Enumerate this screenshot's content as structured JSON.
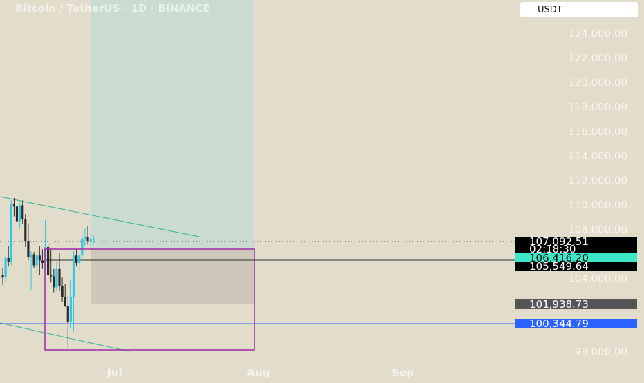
{
  "header": {
    "title": "Bitcoin / TetherUS · 1D · BINANCE",
    "currency_button": "USDT"
  },
  "colors": {
    "background": "#e2dccb",
    "up": "#2ec8e8",
    "down": "#2b2b2b",
    "profit_zone": "#c9dccf",
    "loss_zone": "#cdc8ba",
    "box_outline": "#a02aa8",
    "trendline": "#2db39a",
    "horizontal_line_blue": "#2962ff",
    "tag_current": "#000000",
    "tag_entry": "#3de8c8",
    "tag_gray": "#555555",
    "tag_blue": "#2962ff"
  },
  "chart_data": {
    "type": "candlestick",
    "title": "Bitcoin / TetherUS · 1D · BINANCE",
    "ylim": [
      97000,
      127000
    ],
    "y_ticks": [
      "124,000.00",
      "122,000.00",
      "120,000.00",
      "118,000.00",
      "116,000.00",
      "114,000.00",
      "112,000.00",
      "110,000.00",
      "108,000.00",
      "104,000.00",
      "98,000.00"
    ],
    "x_labels": [
      "Jul",
      "Aug",
      "Sep"
    ],
    "candles": [
      {
        "o": 104200,
        "h": 104800,
        "l": 103400,
        "c": 104000
      },
      {
        "o": 104000,
        "h": 105800,
        "l": 103600,
        "c": 105600
      },
      {
        "o": 105600,
        "h": 106600,
        "l": 104900,
        "c": 105300
      },
      {
        "o": 105300,
        "h": 110300,
        "l": 105000,
        "c": 110000
      },
      {
        "o": 110000,
        "h": 110500,
        "l": 109000,
        "c": 109800
      },
      {
        "o": 109800,
        "h": 110200,
        "l": 108300,
        "c": 108600
      },
      {
        "o": 108600,
        "h": 110100,
        "l": 108000,
        "c": 109900
      },
      {
        "o": 109900,
        "h": 110300,
        "l": 108400,
        "c": 108800
      },
      {
        "o": 108800,
        "h": 109200,
        "l": 106500,
        "c": 107000
      },
      {
        "o": 107000,
        "h": 108400,
        "l": 105400,
        "c": 105700
      },
      {
        "o": 105700,
        "h": 106200,
        "l": 103000,
        "c": 105900
      },
      {
        "o": 105900,
        "h": 106100,
        "l": 104800,
        "c": 105000
      },
      {
        "o": 105000,
        "h": 105900,
        "l": 104400,
        "c": 105800
      },
      {
        "o": 105800,
        "h": 106600,
        "l": 104200,
        "c": 105400
      },
      {
        "o": 105400,
        "h": 106300,
        "l": 104700,
        "c": 105200
      },
      {
        "o": 105200,
        "h": 108700,
        "l": 104600,
        "c": 106500
      },
      {
        "o": 106500,
        "h": 106800,
        "l": 103900,
        "c": 104200
      },
      {
        "o": 104200,
        "h": 106300,
        "l": 103600,
        "c": 104100
      },
      {
        "o": 104100,
        "h": 104700,
        "l": 102800,
        "c": 103200
      },
      {
        "o": 103200,
        "h": 105300,
        "l": 102900,
        "c": 104700
      },
      {
        "o": 104700,
        "h": 106000,
        "l": 102900,
        "c": 103300
      },
      {
        "o": 103300,
        "h": 104000,
        "l": 102000,
        "c": 102400
      },
      {
        "o": 102400,
        "h": 103500,
        "l": 101600,
        "c": 101700
      },
      {
        "o": 101700,
        "h": 102500,
        "l": 98300,
        "c": 100400
      },
      {
        "o": 100400,
        "h": 103800,
        "l": 99900,
        "c": 102400
      },
      {
        "o": 102400,
        "h": 106200,
        "l": 99600,
        "c": 105800
      },
      {
        "o": 105800,
        "h": 106300,
        "l": 104900,
        "c": 105200
      },
      {
        "o": 105200,
        "h": 106100,
        "l": 104600,
        "c": 105800
      },
      {
        "o": 105800,
        "h": 107500,
        "l": 105400,
        "c": 107200
      },
      {
        "o": 107200,
        "h": 108000,
        "l": 106600,
        "c": 107300
      },
      {
        "o": 107300,
        "h": 108200,
        "l": 106700,
        "c": 107000
      },
      {
        "o": 107000,
        "h": 107600,
        "l": 106500,
        "c": 107100
      },
      {
        "o": 107100,
        "h": 107500,
        "l": 106700,
        "c": 107100
      }
    ],
    "price_tags": [
      {
        "label": "107,092.51",
        "sublabel": "02:18:30",
        "kind": "current"
      },
      {
        "label": "106,416.20",
        "kind": "entry"
      },
      {
        "label": "105,549.64",
        "kind": "black"
      },
      {
        "label": "101,938.73",
        "kind": "gray"
      },
      {
        "label": "100,344.79",
        "kind": "blue"
      }
    ],
    "levels": {
      "current": 107092.51,
      "entry": 106416.2,
      "black": 105549.64,
      "gray": 101938.73,
      "blue": 100344.79
    }
  }
}
